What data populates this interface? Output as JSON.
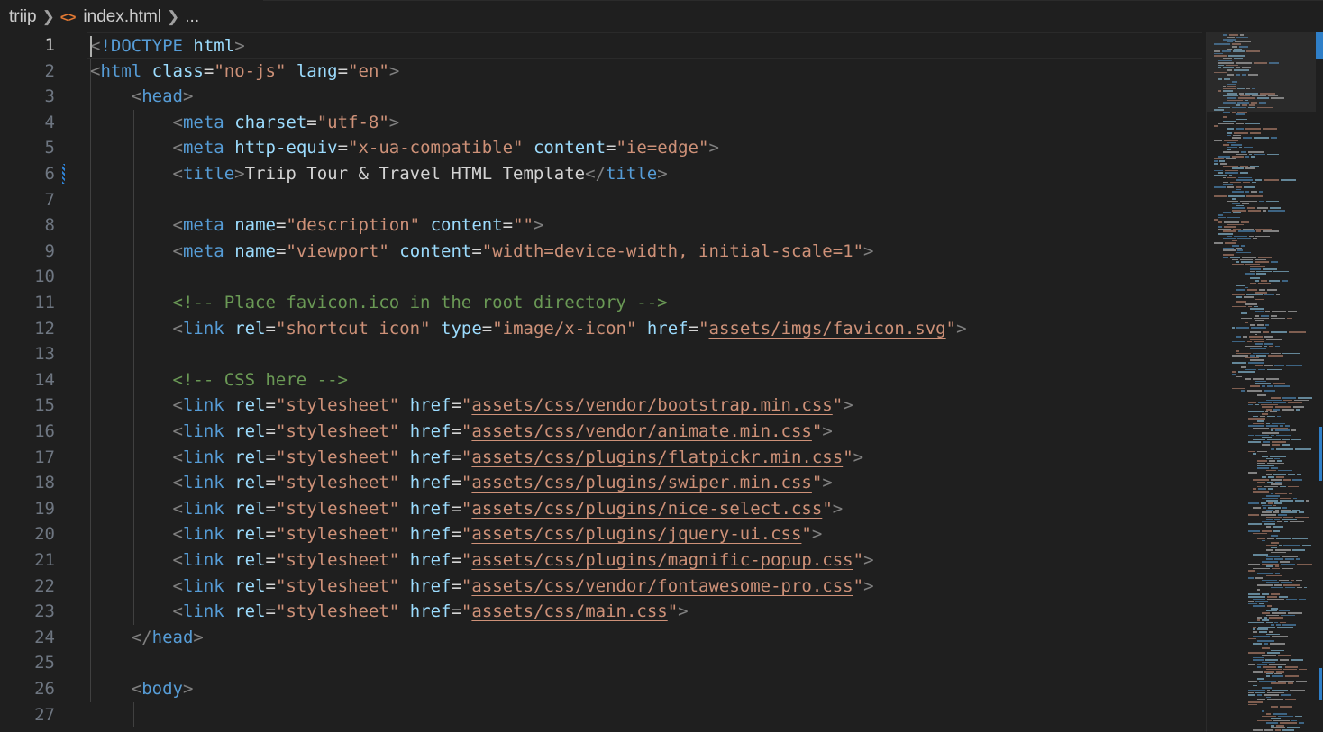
{
  "breadcrumb": {
    "folder": "triip",
    "file": "index.html",
    "more": "...",
    "file_icon": "<>"
  },
  "editor": {
    "active_line": 1,
    "line_numbers": [
      "1",
      "2",
      "3",
      "4",
      "5",
      "6",
      "7",
      "8",
      "9",
      "10",
      "11",
      "12",
      "13",
      "14",
      "15",
      "16",
      "17",
      "18",
      "19",
      "20",
      "21",
      "22",
      "23",
      "24",
      "25",
      "26",
      "27"
    ],
    "lines": [
      [
        [
          "br",
          "<"
        ],
        [
          "tag",
          "!DOCTYPE"
        ],
        [
          "txt",
          " "
        ],
        [
          "attr",
          "html"
        ],
        [
          "br",
          ">"
        ]
      ],
      [
        [
          "br",
          "<"
        ],
        [
          "tag",
          "html"
        ],
        [
          "txt",
          " "
        ],
        [
          "attr",
          "class"
        ],
        [
          "txt",
          "="
        ],
        [
          "str",
          "\"no-js\""
        ],
        [
          "txt",
          " "
        ],
        [
          "attr",
          "lang"
        ],
        [
          "txt",
          "="
        ],
        [
          "str",
          "\"en\""
        ],
        [
          "br",
          ">"
        ]
      ],
      [
        [
          "txt",
          "    "
        ],
        [
          "br",
          "<"
        ],
        [
          "tag",
          "head"
        ],
        [
          "br",
          ">"
        ]
      ],
      [
        [
          "txt",
          "        "
        ],
        [
          "br",
          "<"
        ],
        [
          "tag",
          "meta"
        ],
        [
          "txt",
          " "
        ],
        [
          "attr",
          "charset"
        ],
        [
          "txt",
          "="
        ],
        [
          "str",
          "\"utf-8\""
        ],
        [
          "br",
          ">"
        ]
      ],
      [
        [
          "txt",
          "        "
        ],
        [
          "br",
          "<"
        ],
        [
          "tag",
          "meta"
        ],
        [
          "txt",
          " "
        ],
        [
          "attr",
          "http-equiv"
        ],
        [
          "txt",
          "="
        ],
        [
          "str",
          "\"x-ua-compatible\""
        ],
        [
          "txt",
          " "
        ],
        [
          "attr",
          "content"
        ],
        [
          "txt",
          "="
        ],
        [
          "str",
          "\"ie=edge\""
        ],
        [
          "br",
          ">"
        ]
      ],
      [
        [
          "txt",
          "        "
        ],
        [
          "br",
          "<"
        ],
        [
          "tag",
          "title"
        ],
        [
          "br",
          ">"
        ],
        [
          "txt",
          "Triip Tour & Travel HTML Template"
        ],
        [
          "br",
          "</"
        ],
        [
          "tag",
          "title"
        ],
        [
          "br",
          ">"
        ]
      ],
      [],
      [
        [
          "txt",
          "        "
        ],
        [
          "br",
          "<"
        ],
        [
          "tag",
          "meta"
        ],
        [
          "txt",
          " "
        ],
        [
          "attr",
          "name"
        ],
        [
          "txt",
          "="
        ],
        [
          "str",
          "\"description\""
        ],
        [
          "txt",
          " "
        ],
        [
          "attr",
          "content"
        ],
        [
          "txt",
          "="
        ],
        [
          "str",
          "\"\""
        ],
        [
          "br",
          ">"
        ]
      ],
      [
        [
          "txt",
          "        "
        ],
        [
          "br",
          "<"
        ],
        [
          "tag",
          "meta"
        ],
        [
          "txt",
          " "
        ],
        [
          "attr",
          "name"
        ],
        [
          "txt",
          "="
        ],
        [
          "str",
          "\"viewport\""
        ],
        [
          "txt",
          " "
        ],
        [
          "attr",
          "content"
        ],
        [
          "txt",
          "="
        ],
        [
          "str",
          "\"width=device-width, initial-scale=1\""
        ],
        [
          "br",
          ">"
        ]
      ],
      [],
      [
        [
          "txt",
          "        "
        ],
        [
          "cm",
          "<!-- Place favicon.ico in the root directory -->"
        ]
      ],
      [
        [
          "txt",
          "        "
        ],
        [
          "br",
          "<"
        ],
        [
          "tag",
          "link"
        ],
        [
          "txt",
          " "
        ],
        [
          "attr",
          "rel"
        ],
        [
          "txt",
          "="
        ],
        [
          "str",
          "\"shortcut icon\""
        ],
        [
          "txt",
          " "
        ],
        [
          "attr",
          "type"
        ],
        [
          "txt",
          "="
        ],
        [
          "str",
          "\"image/x-icon\""
        ],
        [
          "txt",
          " "
        ],
        [
          "attr",
          "href"
        ],
        [
          "txt",
          "="
        ],
        [
          "str",
          "\""
        ],
        [
          "link",
          "assets/imgs/favicon.svg"
        ],
        [
          "str",
          "\""
        ],
        [
          "br",
          ">"
        ]
      ],
      [],
      [
        [
          "txt",
          "        "
        ],
        [
          "cm",
          "<!-- CSS here -->"
        ]
      ],
      [
        [
          "txt",
          "        "
        ],
        [
          "br",
          "<"
        ],
        [
          "tag",
          "link"
        ],
        [
          "txt",
          " "
        ],
        [
          "attr",
          "rel"
        ],
        [
          "txt",
          "="
        ],
        [
          "str",
          "\"stylesheet\""
        ],
        [
          "txt",
          " "
        ],
        [
          "attr",
          "href"
        ],
        [
          "txt",
          "="
        ],
        [
          "str",
          "\""
        ],
        [
          "link",
          "assets/css/vendor/bootstrap.min.css"
        ],
        [
          "str",
          "\""
        ],
        [
          "br",
          ">"
        ]
      ],
      [
        [
          "txt",
          "        "
        ],
        [
          "br",
          "<"
        ],
        [
          "tag",
          "link"
        ],
        [
          "txt",
          " "
        ],
        [
          "attr",
          "rel"
        ],
        [
          "txt",
          "="
        ],
        [
          "str",
          "\"stylesheet\""
        ],
        [
          "txt",
          " "
        ],
        [
          "attr",
          "href"
        ],
        [
          "txt",
          "="
        ],
        [
          "str",
          "\""
        ],
        [
          "link",
          "assets/css/vendor/animate.min.css"
        ],
        [
          "str",
          "\""
        ],
        [
          "br",
          ">"
        ]
      ],
      [
        [
          "txt",
          "        "
        ],
        [
          "br",
          "<"
        ],
        [
          "tag",
          "link"
        ],
        [
          "txt",
          " "
        ],
        [
          "attr",
          "rel"
        ],
        [
          "txt",
          "="
        ],
        [
          "str",
          "\"stylesheet\""
        ],
        [
          "txt",
          " "
        ],
        [
          "attr",
          "href"
        ],
        [
          "txt",
          "="
        ],
        [
          "str",
          "\""
        ],
        [
          "link",
          "assets/css/plugins/flatpickr.min.css"
        ],
        [
          "str",
          "\""
        ],
        [
          "br",
          ">"
        ]
      ],
      [
        [
          "txt",
          "        "
        ],
        [
          "br",
          "<"
        ],
        [
          "tag",
          "link"
        ],
        [
          "txt",
          " "
        ],
        [
          "attr",
          "rel"
        ],
        [
          "txt",
          "="
        ],
        [
          "str",
          "\"stylesheet\""
        ],
        [
          "txt",
          " "
        ],
        [
          "attr",
          "href"
        ],
        [
          "txt",
          "="
        ],
        [
          "str",
          "\""
        ],
        [
          "link",
          "assets/css/plugins/swiper.min.css"
        ],
        [
          "str",
          "\""
        ],
        [
          "br",
          ">"
        ]
      ],
      [
        [
          "txt",
          "        "
        ],
        [
          "br",
          "<"
        ],
        [
          "tag",
          "link"
        ],
        [
          "txt",
          " "
        ],
        [
          "attr",
          "rel"
        ],
        [
          "txt",
          "="
        ],
        [
          "str",
          "\"stylesheet\""
        ],
        [
          "txt",
          " "
        ],
        [
          "attr",
          "href"
        ],
        [
          "txt",
          "="
        ],
        [
          "str",
          "\""
        ],
        [
          "link",
          "assets/css/plugins/nice-select.css"
        ],
        [
          "str",
          "\""
        ],
        [
          "br",
          ">"
        ]
      ],
      [
        [
          "txt",
          "        "
        ],
        [
          "br",
          "<"
        ],
        [
          "tag",
          "link"
        ],
        [
          "txt",
          " "
        ],
        [
          "attr",
          "rel"
        ],
        [
          "txt",
          "="
        ],
        [
          "str",
          "\"stylesheet\""
        ],
        [
          "txt",
          " "
        ],
        [
          "attr",
          "href"
        ],
        [
          "txt",
          "="
        ],
        [
          "str",
          "\""
        ],
        [
          "link",
          "assets/css/plugins/jquery-ui.css"
        ],
        [
          "str",
          "\""
        ],
        [
          "br",
          ">"
        ]
      ],
      [
        [
          "txt",
          "        "
        ],
        [
          "br",
          "<"
        ],
        [
          "tag",
          "link"
        ],
        [
          "txt",
          " "
        ],
        [
          "attr",
          "rel"
        ],
        [
          "txt",
          "="
        ],
        [
          "str",
          "\"stylesheet\""
        ],
        [
          "txt",
          " "
        ],
        [
          "attr",
          "href"
        ],
        [
          "txt",
          "="
        ],
        [
          "str",
          "\""
        ],
        [
          "link",
          "assets/css/plugins/magnific-popup.css"
        ],
        [
          "str",
          "\""
        ],
        [
          "br",
          ">"
        ]
      ],
      [
        [
          "txt",
          "        "
        ],
        [
          "br",
          "<"
        ],
        [
          "tag",
          "link"
        ],
        [
          "txt",
          " "
        ],
        [
          "attr",
          "rel"
        ],
        [
          "txt",
          "="
        ],
        [
          "str",
          "\"stylesheet\""
        ],
        [
          "txt",
          " "
        ],
        [
          "attr",
          "href"
        ],
        [
          "txt",
          "="
        ],
        [
          "str",
          "\""
        ],
        [
          "link",
          "assets/css/vendor/fontawesome-pro.css"
        ],
        [
          "str",
          "\""
        ],
        [
          "br",
          ">"
        ]
      ],
      [
        [
          "txt",
          "        "
        ],
        [
          "br",
          "<"
        ],
        [
          "tag",
          "link"
        ],
        [
          "txt",
          " "
        ],
        [
          "attr",
          "rel"
        ],
        [
          "txt",
          "="
        ],
        [
          "str",
          "\"stylesheet\""
        ],
        [
          "txt",
          " "
        ],
        [
          "attr",
          "href"
        ],
        [
          "txt",
          "="
        ],
        [
          "str",
          "\""
        ],
        [
          "link",
          "assets/css/main.css"
        ],
        [
          "str",
          "\""
        ],
        [
          "br",
          ">"
        ]
      ],
      [
        [
          "txt",
          "    "
        ],
        [
          "br",
          "</"
        ],
        [
          "tag",
          "head"
        ],
        [
          "br",
          ">"
        ]
      ],
      [],
      [
        [
          "txt",
          "    "
        ],
        [
          "br",
          "<"
        ],
        [
          "tag",
          "body"
        ],
        [
          "br",
          ">"
        ]
      ],
      []
    ]
  },
  "colors": {
    "background": "#1f1f1f",
    "tag": "#569cd6",
    "attribute": "#9cdcfe",
    "string": "#ce9178",
    "comment": "#6a9955",
    "bracket": "#808080",
    "text": "#d4d4d4",
    "git_modified": "#2f83d6"
  }
}
